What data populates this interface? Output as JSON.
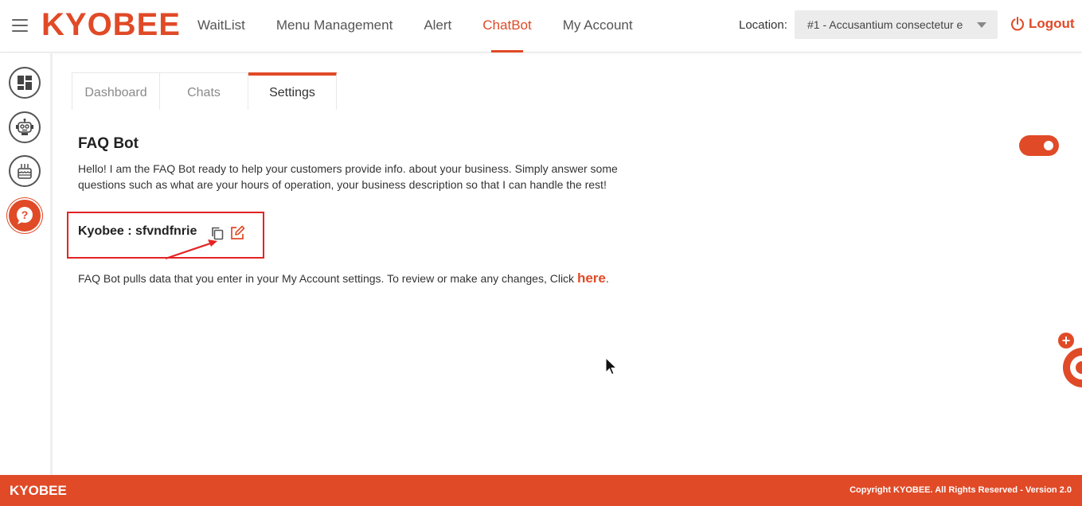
{
  "header": {
    "logo": "KYOBEE",
    "nav": [
      {
        "label": "WaitList"
      },
      {
        "label": "Menu Management"
      },
      {
        "label": "Alert"
      },
      {
        "label": "ChatBot"
      },
      {
        "label": "My Account"
      }
    ],
    "active_nav": "ChatBot",
    "location_label": "Location:",
    "location_value": "#1 - Accusantium consectetur e",
    "logout_label": "Logout"
  },
  "sidebar": {
    "items": [
      {
        "icon": "dashboard-icon"
      },
      {
        "icon": "robot-icon"
      },
      {
        "icon": "cake-icon"
      },
      {
        "icon": "help-icon"
      }
    ]
  },
  "tabs": [
    {
      "label": "Dashboard"
    },
    {
      "label": "Chats"
    },
    {
      "label": "Settings"
    }
  ],
  "active_tab": "Settings",
  "faq": {
    "title": "FAQ Bot",
    "description": "Hello! I am the FAQ Bot ready to help your customers provide info. about your business. Simply answer some questions such as what are your hours of operation, your business description so that I can handle the rest!",
    "toggle_on": true,
    "bot_name": "Kyobee : sfvndfnrie",
    "pull_text": "FAQ Bot pulls data that you enter in your My Account settings. To review or make any changes, Click ",
    "here_link": "here",
    "period": "."
  },
  "footer": {
    "brand": "KYOBEE",
    "copyright": "Copyright KYOBEE. All Rights Reserved - Version 2.0"
  },
  "colors": {
    "accent": "#e04a27",
    "highlight_box": "#e32424"
  }
}
